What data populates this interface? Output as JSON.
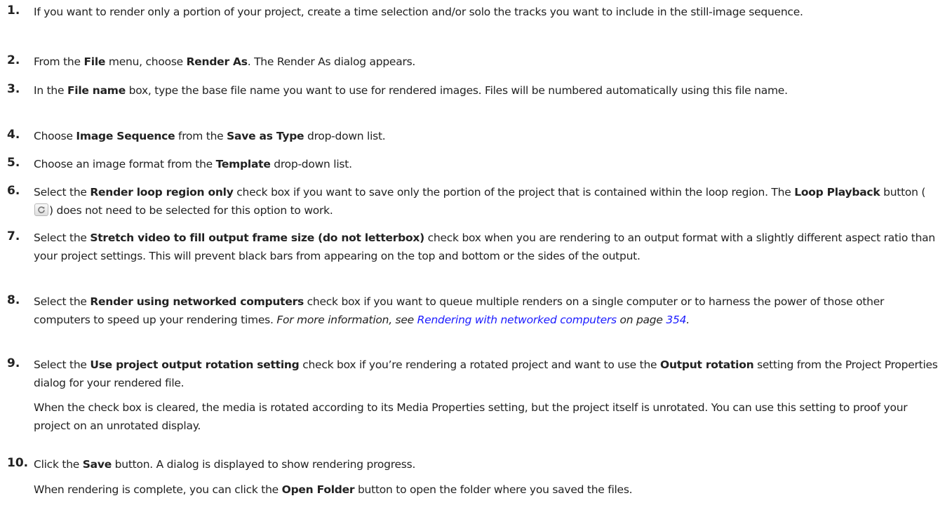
{
  "steps": [
    {
      "num": "1.",
      "t1": "If you want to render only a portion of your project, create a time selection and/or solo the tracks you want to include in the still-image sequence."
    },
    {
      "num": "2.",
      "t1": "From the ",
      "b1": "File",
      "t2": " menu, choose ",
      "b2": "Render As",
      "t3": ". The Render As dialog appears."
    },
    {
      "num": "3.",
      "t1": "In the ",
      "b1": "File name",
      "t2": " box, type the base file name you want to use for rendered images. Files will be numbered automatically using this file name."
    },
    {
      "num": "4.",
      "t1": "Choose ",
      "b1": "Image Sequence",
      "t2": " from the ",
      "b2": "Save as Type",
      "t3": " drop-down list."
    },
    {
      "num": "5.",
      "t1": "Choose an image format from the ",
      "b1": "Template",
      "t2": " drop-down list."
    },
    {
      "num": "6.",
      "t1": "Select the ",
      "b1": "Render loop region only",
      "t2": " check box if you want to save only the portion of the project that is contained within the loop region. The ",
      "b2": "Loop Playback",
      "t3": " button (",
      "icon": "loop-playback-icon",
      "t4": ") does not need to be selected for this option to work."
    },
    {
      "num": "7.",
      "t1": "Select the ",
      "b1": "Stretch video to fill output frame size (do not letterbox)",
      "t2": " check box when you are rendering to an output format with a slightly different aspect ratio than your project settings. This will prevent black bars from appearing on the top and bottom or the sides of the output."
    },
    {
      "num": "8.",
      "t1": "Select the ",
      "b1": "Render using networked computers",
      "t2": " check box if you want to queue multiple renders on a single computer or to harness the power of those other computers to speed up your rendering times. ",
      "i1": "For more information, see ",
      "link1": "Rendering with networked computers",
      "i2": " on page ",
      "link2": "354",
      "i3": "."
    },
    {
      "num": "9.",
      "t1": "Select the ",
      "b1": "Use project output rotation setting",
      "t2": " check box if you’re rendering a rotated project and want to use the ",
      "b2": "Output rotation",
      "t3": " setting from the Project Properties dialog for your rendered file.",
      "p2": "When the check box is cleared, the media is rotated according to its Media Properties setting, but the project itself is unrotated. You can use this setting to proof your project on an unrotated display."
    },
    {
      "num": "10.",
      "t1": "Click the ",
      "b1": "Save",
      "t2": " button. A dialog is displayed to show rendering progress.",
      "p2a": "When rendering is complete, you can click the ",
      "p2b": "Open Folder",
      "p2c": " button to open the folder where you saved the files."
    }
  ],
  "colors": {
    "text": "#222222",
    "link": "#1a1aff"
  }
}
